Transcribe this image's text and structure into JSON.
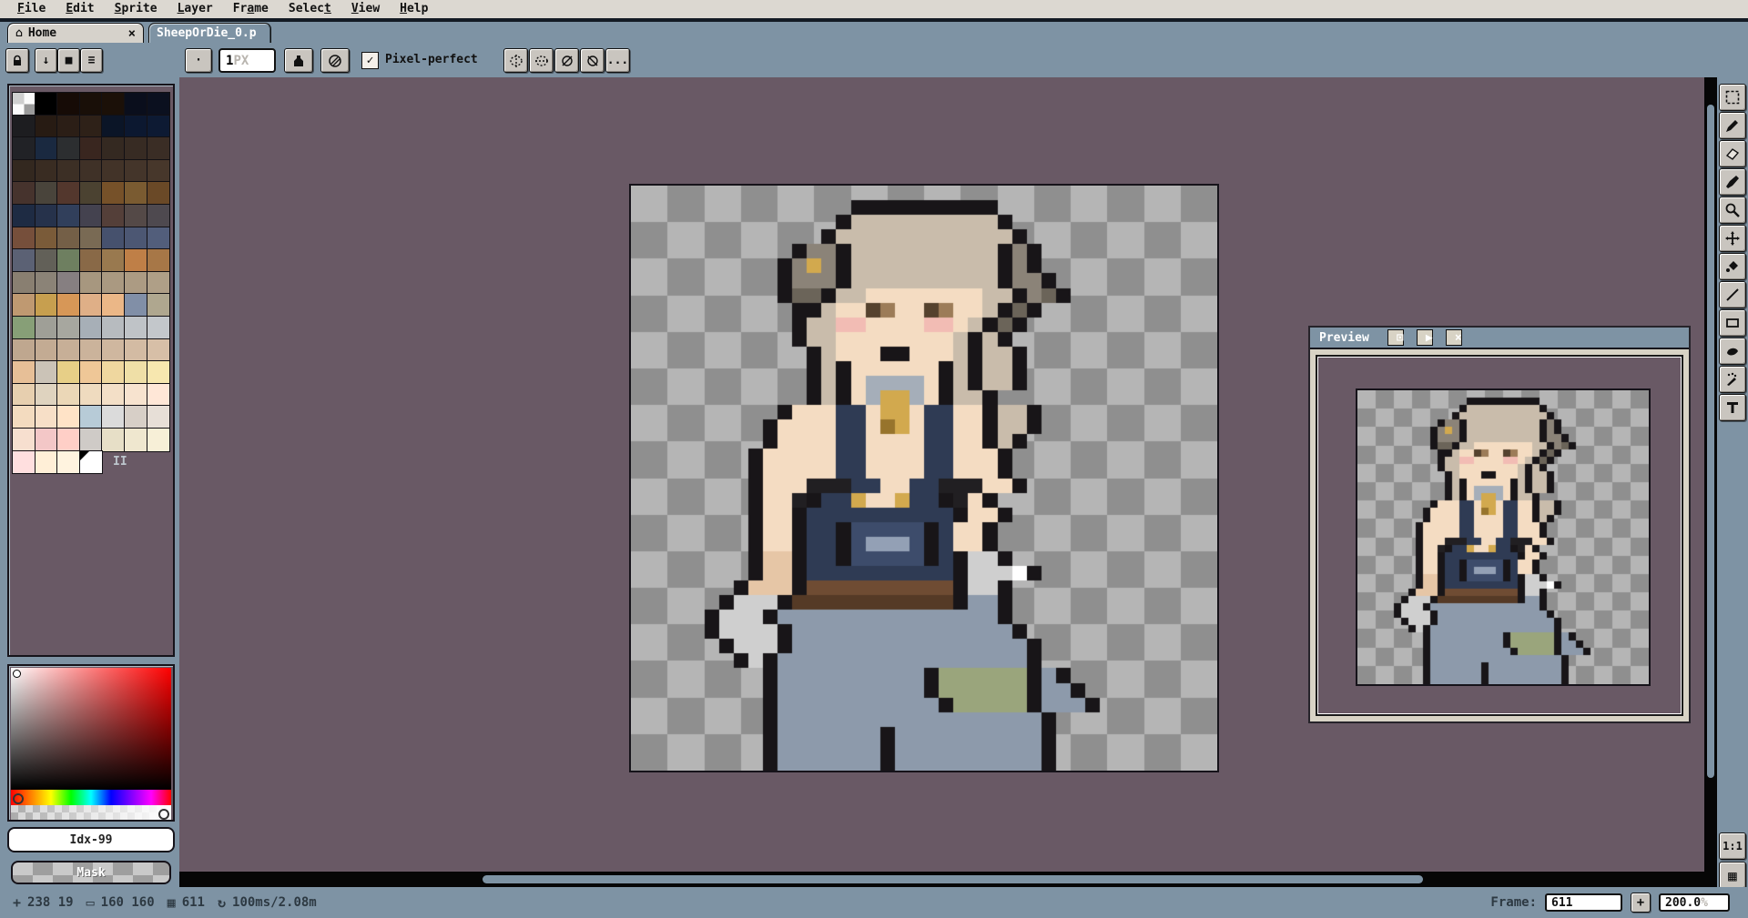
{
  "colors": {
    "chrome": "#7e93a4",
    "menubar_bg": "#dcd8d1",
    "canvas_bg": "#695965",
    "button_face": "#c9c5bf",
    "checker_light": "#b5b5b5",
    "checker_dark": "#8f8f8f"
  },
  "menu": {
    "items": [
      {
        "label": "File",
        "u": 0
      },
      {
        "label": "Edit",
        "u": 0
      },
      {
        "label": "Sprite",
        "u": 0
      },
      {
        "label": "Layer",
        "u": 0
      },
      {
        "label": "Frame",
        "u": 2
      },
      {
        "label": "Select",
        "u": 5
      },
      {
        "label": "View",
        "u": 0
      },
      {
        "label": "Help",
        "u": 0
      }
    ]
  },
  "tabs": {
    "home": {
      "label": "Home",
      "icon": "⌂",
      "close": "×"
    },
    "sprite": {
      "label": "SheepOrDie_0.p"
    }
  },
  "toolbar": {
    "size_value": "1",
    "size_unit": "PX",
    "pixel_perfect_label": "Pixel-perfect",
    "check_glyph": "✓",
    "arrow_down_glyph": "↓",
    "square_glyph": "■",
    "menu_glyph": "≡",
    "dot_glyph": "·",
    "more_label": "..."
  },
  "palette": {
    "index_label": "Idx-99",
    "mask_label": "Mask",
    "separator_label": "II",
    "selected_index": 115,
    "swatches": [
      "checker",
      "#000000",
      "#160b06",
      "#190f08",
      "#1b1008",
      "#0a0e1c",
      "#0b101f",
      "#1d1d20",
      "#271b13",
      "#2b1e16",
      "#2e2118",
      "#0b1527",
      "#0c1830",
      "#0d1a33",
      "#212226",
      "#1a2940",
      "#2c2e30",
      "#39261f",
      "#342921",
      "#372b23",
      "#3a2d25",
      "#33281f",
      "#392c22",
      "#3c2f25",
      "#3f3127",
      "#423328",
      "#44352a",
      "#47372b",
      "#46332d",
      "#49443b",
      "#53372d",
      "#4b4231",
      "#765129",
      "#7a5b31",
      "#6a4927",
      "#1e2b43",
      "#26324b",
      "#313f5b",
      "#44424f",
      "#543f39",
      "#544947",
      "#4e494f",
      "#764f3b",
      "#7a5b39",
      "#745f47",
      "#796a54",
      "#46516d",
      "#4c5773",
      "#525e7b",
      "#5b6174",
      "#626058",
      "#6e7f60",
      "#896947",
      "#99794f",
      "#bf7f47",
      "#a77747",
      "#897f71",
      "#8b8377",
      "#867f81",
      "#a7977f",
      "#aa9981",
      "#ac9b83",
      "#af9f87",
      "#bf9971",
      "#c79f4f",
      "#d79757",
      "#dfaf87",
      "#ebb787",
      "#818fa7",
      "#afa78f",
      "#879f77",
      "#9f9f97",
      "#a7a79f",
      "#a7afb7",
      "#b7bbbf",
      "#bfc3c7",
      "#c3c7cb",
      "#bfa78f",
      "#c3ab93",
      "#c7af97",
      "#cbb39b",
      "#cfb79f",
      "#d3bba3",
      "#d7bfa7",
      "#e7bf97",
      "#cbc3b7",
      "#e7cf87",
      "#efc797",
      "#efd79f",
      "#efdfa7",
      "#f7e7af",
      "#e7cfaf",
      "#dfd3bf",
      "#ebd7b7",
      "#efdbbf",
      "#f3dfc7",
      "#f7e3cf",
      "#ffe7d7",
      "#f3dbbf",
      "#f7dfc7",
      "#ffe3c7",
      "#b7cbd7",
      "#dbdbdb",
      "#d7cfc7",
      "#e7dfd7",
      "#f7dfcf",
      "#f3c7c7",
      "#ffcfc7",
      "#cfcbc7",
      "#e7dfc7",
      "#efe7cf",
      "#f7efd7",
      "#ffdfdf",
      "#ffefd7",
      "#fff3df",
      "#ffffff"
    ]
  },
  "right_toolbar": {
    "tools": [
      "rectangular-marquee",
      "pencil",
      "eraser",
      "eyedropper",
      "zoom",
      "move",
      "paint-bucket",
      "line",
      "rectangle",
      "contour",
      "spray",
      "text"
    ],
    "one_to_one_label": "1:1",
    "timeline_glyph": "▦"
  },
  "preview": {
    "title": "Preview",
    "center_glyph": "⊡",
    "play_glyph": "▶",
    "close_glyph": "×"
  },
  "status": {
    "pos_icon": "+",
    "pos": "238 19",
    "size_icon": "▭",
    "size": "160 160",
    "frame_icon": "▦",
    "frame": "611",
    "time_icon": "↻",
    "time": "100ms/2.08m",
    "frame_label": "Frame:",
    "frame_value": "611",
    "add_label": "+",
    "zoom_value": "200.0",
    "zoom_suffix": "%"
  },
  "pixel_art": {
    "grid": 40,
    "palette": {
      "k": "#181518",
      "h": "#c9bcab",
      "f": "#f4dcc2",
      "F": "#e6c6a6",
      "E": "#55422e",
      "e": "#9c7c58",
      "b": "#f2bcb4",
      "g": "#8b8378",
      "G": "#6b6459",
      "y": "#d2a94e",
      "Y": "#97742c",
      "c": "#a5aeb9",
      "o": "#2f3b54",
      "p": "#3d4c6b",
      "t": "#93a0b5",
      "B": "#211f22",
      "r": "#6f4c33",
      "R": "#553a26",
      "j": "#8d9aab",
      "n": "#9aa57c",
      "v": "#cfcfcf",
      "w": "#ffffff"
    },
    "rows": [
      "40.",
      "15.10k15.",
      "14.1k10h1k14.",
      "13.1k12h1k13.",
      "11.1k2g1k10h1k1g1k12.",
      "10.1k1g1y1g1k10h1k1g1k12.",
      "10.1k3g1k10h1k2g1k11.",
      "10.1k2G1k2h8f2h1k1g1G1k10.",
      "11.2k1h2f1E1e2f1E1e2f1h1k1G1k12.",
      "11.1k2h2b4f2b1f1h1k1G1k13.",
      "11.1k2h8f1h1k1h1k14.",
      "12.1k1h3f2k3f1h1k2h1k13.",
      "12.1k1h1k6f1k1h1k2h1k13.",
      "12.1k1h1k1f4c1f1k1h1k2h1k13.",
      "12.1k1h1k1f1c2y1c1f1k2h1k15.",
      "10.1k3f2o1f2y1f2o2f1k2h1k12.",
      "9.1k4f2o1f1Y1y1f2o2f1k2h1k12.",
      "9.1k4f2o4f2o2f1k1h1k13.",
      "8.1k5f2o4f2o3f1k14.",
      "8.1k5f2o4f2o3f1k14.",
      "8.1k3f3B2o2f2o3B2f1k13.",
      "8.1k2f1B1k2o1y2f1y2o1k1B1f1k15.",
      "8.1k2f1k10o1k2f1k14.",
      "8.1k2f1k2o1k5p1k1o2f1k15.",
      "8.1k2f1k2o1k1p3t1p1k1o2f1k15.",
      "8.1k2F1k2o1k5p1k1o1k2v1k14.",
      "8.1k2F1k10o1k3v1w1k12.",
      "7.1k3F1k10r1k2v1k14.",
      "6.1k3v1k11R1k2j1k14.",
      "5.1k3v1k15j1k14.",
      "5.1k4v1k15j1k13.",
      "6.1k3v1k16j1k12.",
      "7.1k1v1k17j1k12.",
      "9.1k10j1k6n1k1j1k10.",
      "9.1k10j1k6n1k2j1k9.",
      "9.1k11j1k5n1k3j1k8.",
      "9.1k18j1k11.",
      "9.1k7j1k10j1k11.",
      "9.1k7j1k10j1k11.",
      "9.1k7j1k10j1k11."
    ]
  }
}
